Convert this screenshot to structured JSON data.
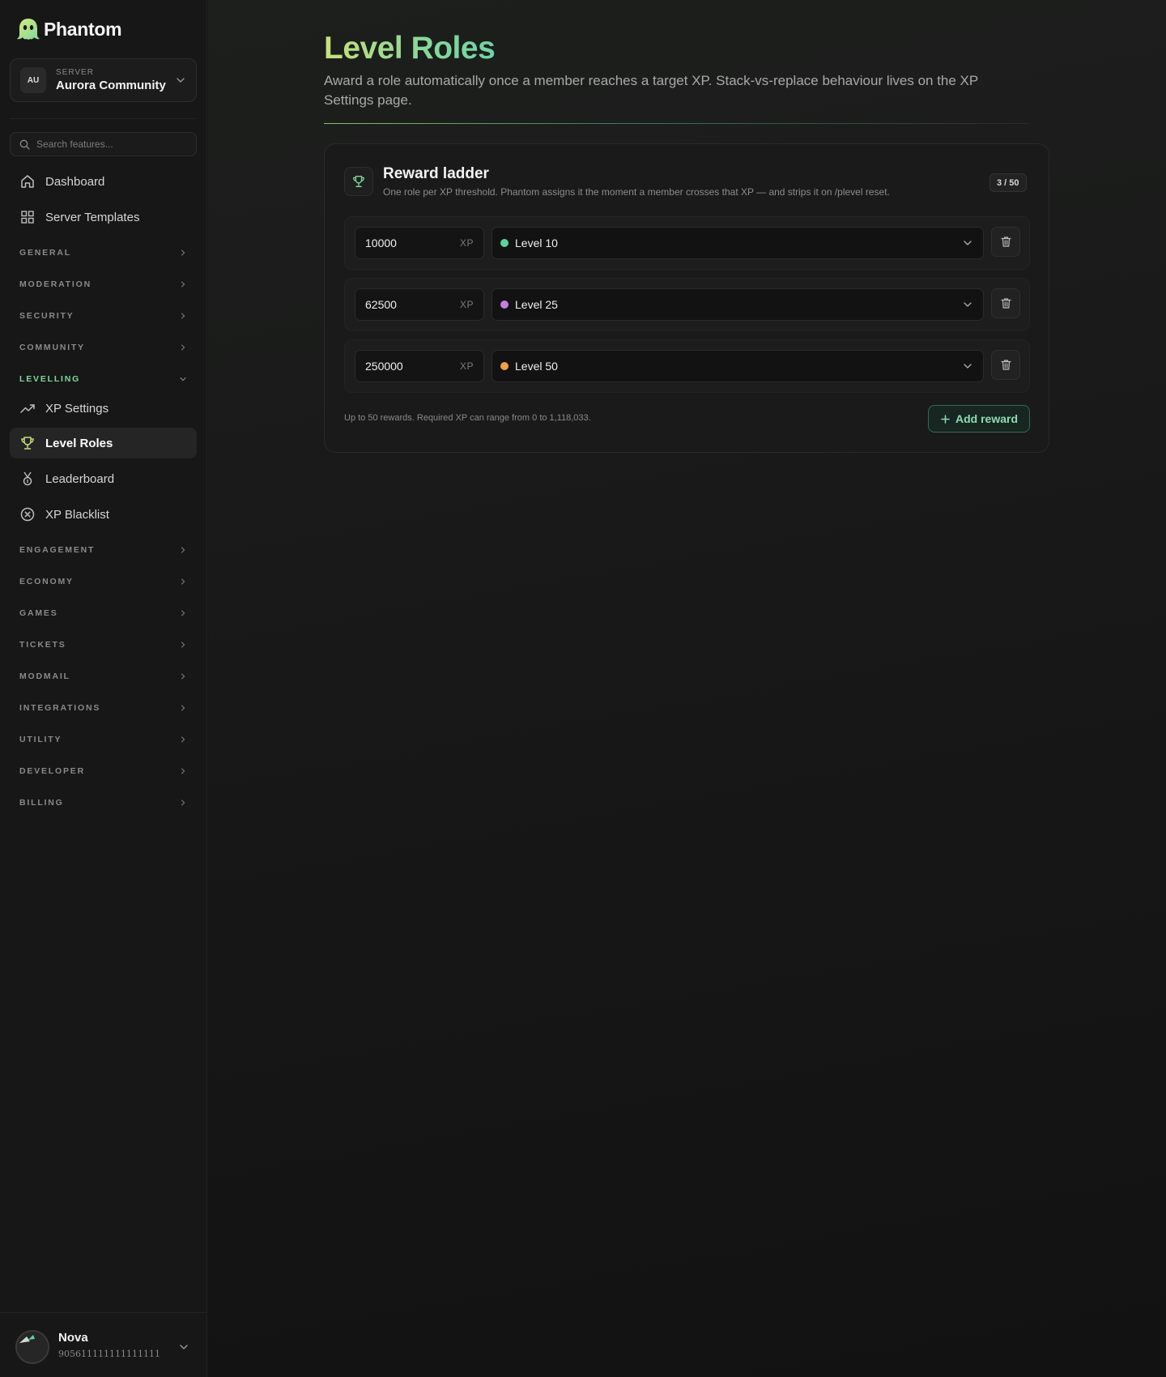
{
  "brand": {
    "name": "Phantom",
    "logo_icon": "ghost-logo"
  },
  "server": {
    "label": "SERVER",
    "initials": "AU",
    "name": "Aurora Community"
  },
  "search": {
    "placeholder": "Search features..."
  },
  "nav_top": [
    {
      "label": "Dashboard",
      "icon": "home-icon"
    },
    {
      "label": "Server Templates",
      "icon": "grid-icon"
    }
  ],
  "sections": {
    "general": "GENERAL",
    "moderation": "MODERATION",
    "security": "SECURITY",
    "community": "COMMUNITY",
    "levelling": "LEVELLING",
    "engagement": "ENGAGEMENT",
    "economy": "ECONOMY",
    "games": "GAMES",
    "tickets": "TICKETS",
    "modmail": "MODMAIL",
    "integrations": "INTEGRATIONS",
    "utility": "UTILITY",
    "developer": "DEVELOPER",
    "billing": "BILLING"
  },
  "levelling_items": [
    {
      "label": "XP Settings",
      "icon": "trend-up-icon"
    },
    {
      "label": "Level Roles",
      "icon": "trophy-icon",
      "active": true
    },
    {
      "label": "Leaderboard",
      "icon": "medal-icon"
    },
    {
      "label": "XP Blacklist",
      "icon": "x-circle-icon"
    }
  ],
  "user": {
    "name": "Nova",
    "id": "905611111111111111"
  },
  "page": {
    "title": "Level Roles",
    "subtitle": "Award a role automatically once a member reaches a target XP. Stack-vs-replace behaviour lives on the XP Settings page."
  },
  "card": {
    "title": "Reward ladder",
    "description": "One role per XP threshold. Phantom assigns it the moment a member crosses that XP — and strips it on /plevel reset.",
    "count": "3 / 50",
    "footer": "Up to 50 rewards. Required XP can range from 0 to 1,118,033.",
    "add_label": "Add reward"
  },
  "rewards": [
    {
      "xp": "10000",
      "unit": "XP",
      "role": "Level 10",
      "color": "#5fd39a"
    },
    {
      "xp": "62500",
      "unit": "XP",
      "role": "Level 25",
      "color": "#c77ddf"
    },
    {
      "xp": "250000",
      "unit": "XP",
      "role": "Level 50",
      "color": "#f0a04b"
    }
  ],
  "colors": {
    "accent": "#7fd6a0",
    "title_gradient_start": "#c8e07a",
    "title_gradient_end": "#6fd3a6"
  }
}
